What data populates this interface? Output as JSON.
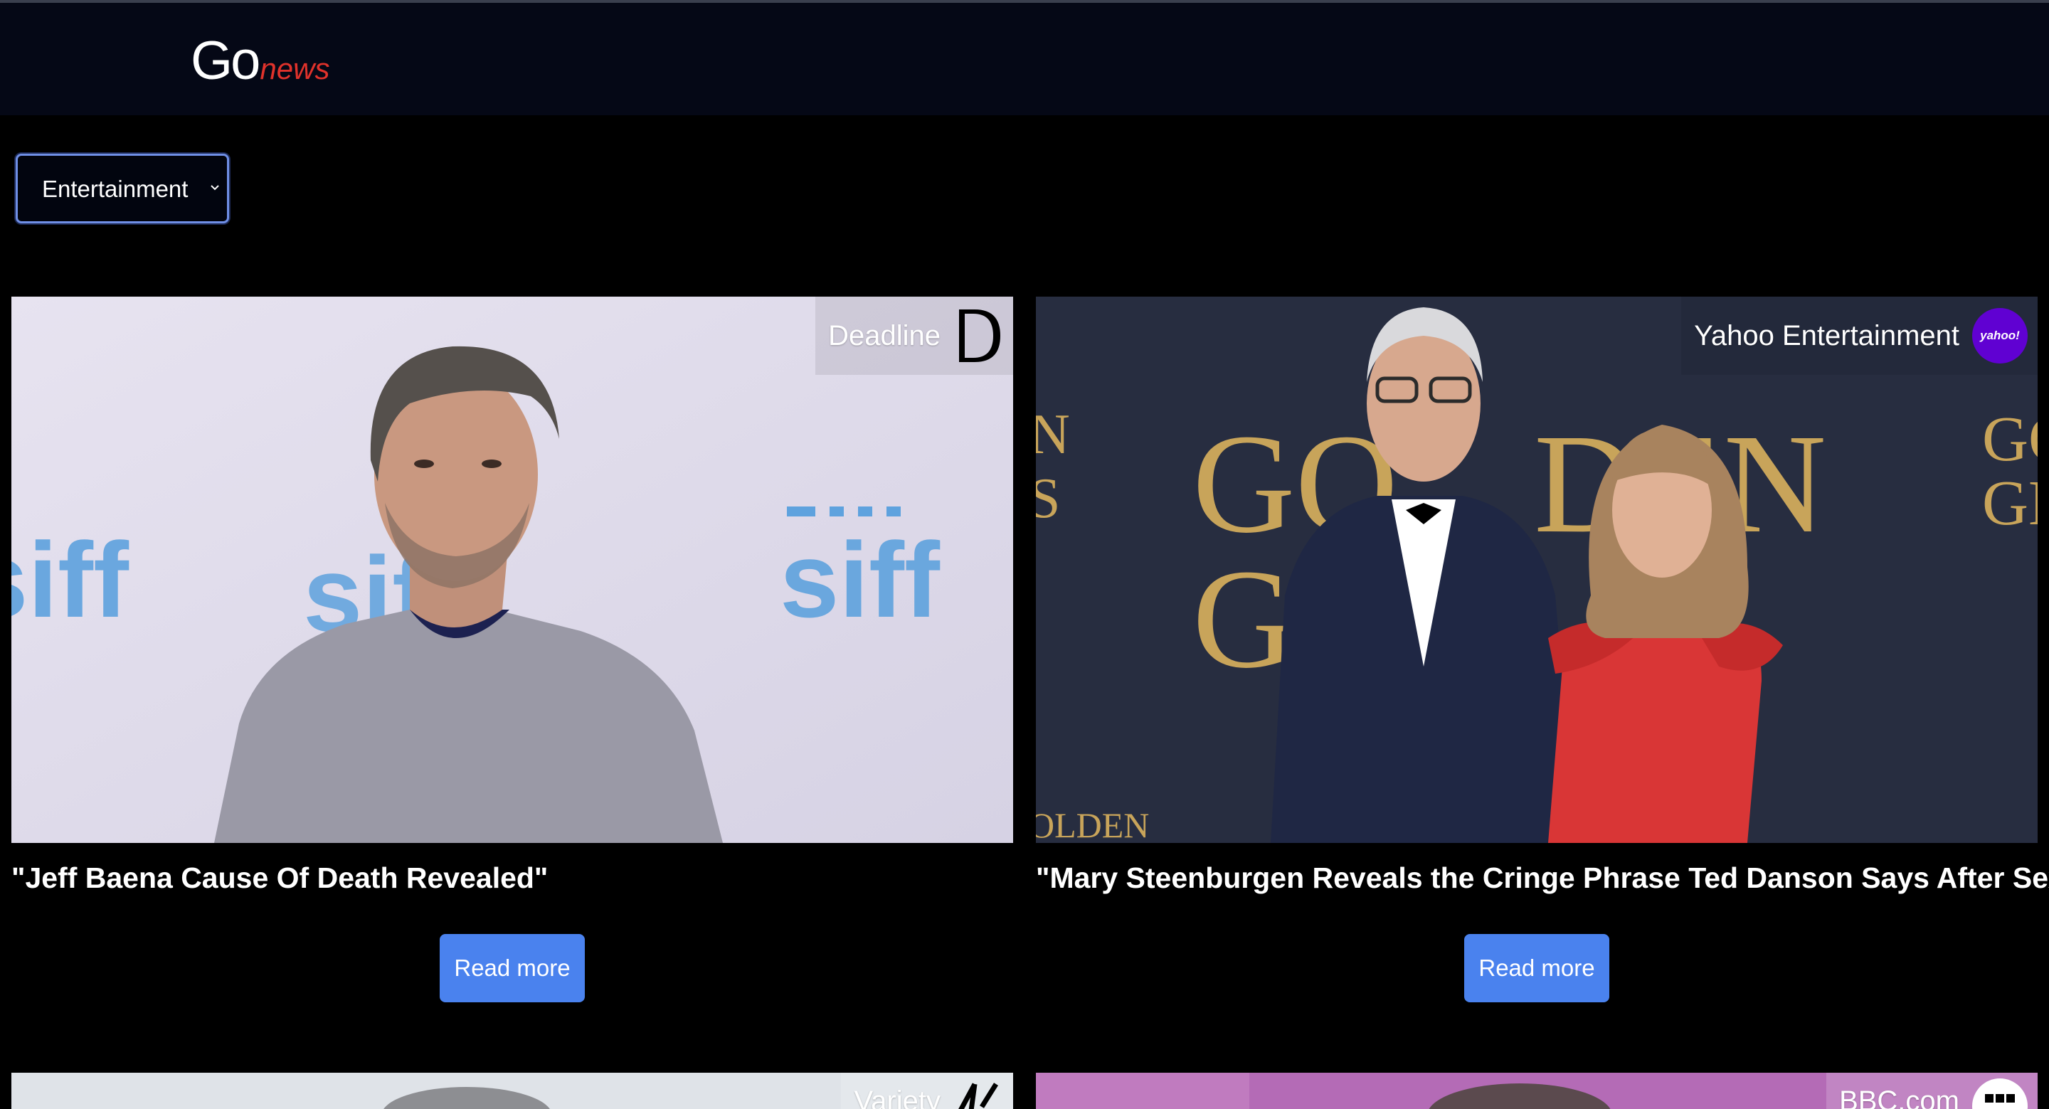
{
  "brand": {
    "main": "Go",
    "accent": "news",
    "accent_color": "#e0322b"
  },
  "category_select": {
    "value": "Entertainment"
  },
  "articles": [
    {
      "source": "Deadline",
      "source_icon": "deadline-d-logo",
      "title": "\"Jeff Baena Cause Of Death Revealed\"",
      "button": "Read more"
    },
    {
      "source": "Yahoo Entertainment",
      "source_icon": "yahoo-logo",
      "source_icon_text": "yahoo!",
      "title": "\"Mary Steenburgen Reveals the Cringe Phrase Ted Danson Says After Sex\"",
      "button": "Read more"
    },
    {
      "source": "Variety",
      "source_icon": "variety-v-logo"
    },
    {
      "source": "BBC.com",
      "source_icon": "bbc-logo"
    }
  ],
  "colors": {
    "button": "#4a82ee",
    "navbar": "#050816",
    "background": "#000000"
  }
}
